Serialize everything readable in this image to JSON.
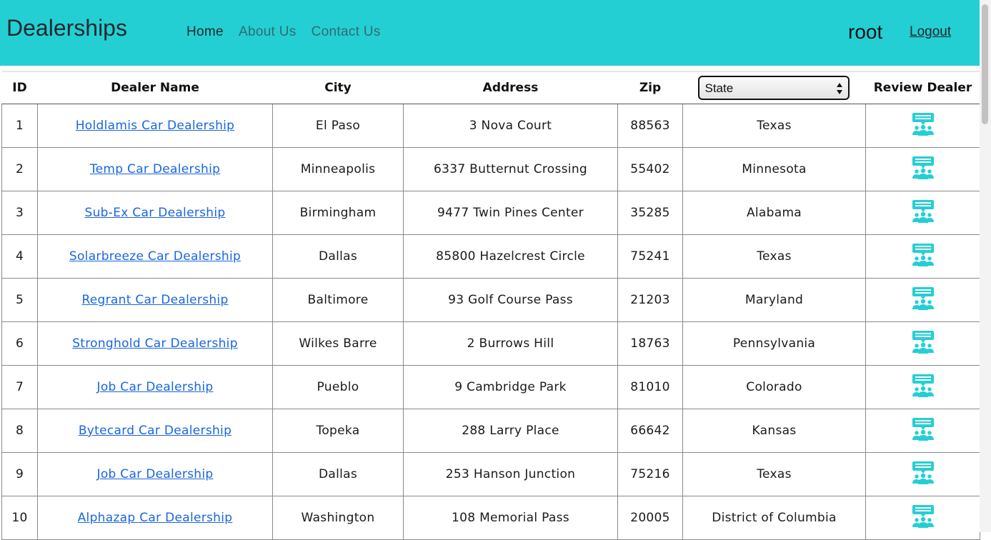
{
  "navbar": {
    "brand": "Dealerships",
    "links": [
      "Home",
      "About Us",
      "Contact Us"
    ],
    "username": "root",
    "logout_label": "Logout"
  },
  "table": {
    "headers": {
      "id": "ID",
      "name": "Dealer Name",
      "city": "City",
      "address": "Address",
      "zip": "Zip",
      "review": "Review Dealer"
    },
    "state_filter": {
      "selected": "State"
    },
    "rows": [
      {
        "id": "1",
        "name": "Holdlamis Car Dealership",
        "city": "El Paso",
        "address": "3 Nova Court",
        "zip": "88563",
        "state": "Texas"
      },
      {
        "id": "2",
        "name": "Temp Car Dealership",
        "city": "Minneapolis",
        "address": "6337 Butternut Crossing",
        "zip": "55402",
        "state": "Minnesota"
      },
      {
        "id": "3",
        "name": "Sub-Ex Car Dealership",
        "city": "Birmingham",
        "address": "9477 Twin Pines Center",
        "zip": "35285",
        "state": "Alabama"
      },
      {
        "id": "4",
        "name": "Solarbreeze Car Dealership",
        "city": "Dallas",
        "address": "85800 Hazelcrest Circle",
        "zip": "75241",
        "state": "Texas"
      },
      {
        "id": "5",
        "name": "Regrant Car Dealership",
        "city": "Baltimore",
        "address": "93 Golf Course Pass",
        "zip": "21203",
        "state": "Maryland"
      },
      {
        "id": "6",
        "name": "Stronghold Car Dealership",
        "city": "Wilkes Barre",
        "address": "2 Burrows Hill",
        "zip": "18763",
        "state": "Pennsylvania"
      },
      {
        "id": "7",
        "name": "Job Car Dealership",
        "city": "Pueblo",
        "address": "9 Cambridge Park",
        "zip": "81010",
        "state": "Colorado"
      },
      {
        "id": "8",
        "name": "Bytecard Car Dealership",
        "city": "Topeka",
        "address": "288 Larry Place",
        "zip": "66642",
        "state": "Kansas"
      },
      {
        "id": "9",
        "name": "Job Car Dealership",
        "city": "Dallas",
        "address": "253 Hanson Junction",
        "zip": "75216",
        "state": "Texas"
      },
      {
        "id": "10",
        "name": "Alphazap Car Dealership",
        "city": "Washington",
        "address": "108 Memorial Pass",
        "zip": "20005",
        "state": "District of Columbia"
      }
    ]
  },
  "icons": {
    "review": "review-dealer-icon"
  },
  "colors": {
    "navbar": "#24cfd3",
    "link": "#1a66e0",
    "icon": "#24cfd3"
  }
}
